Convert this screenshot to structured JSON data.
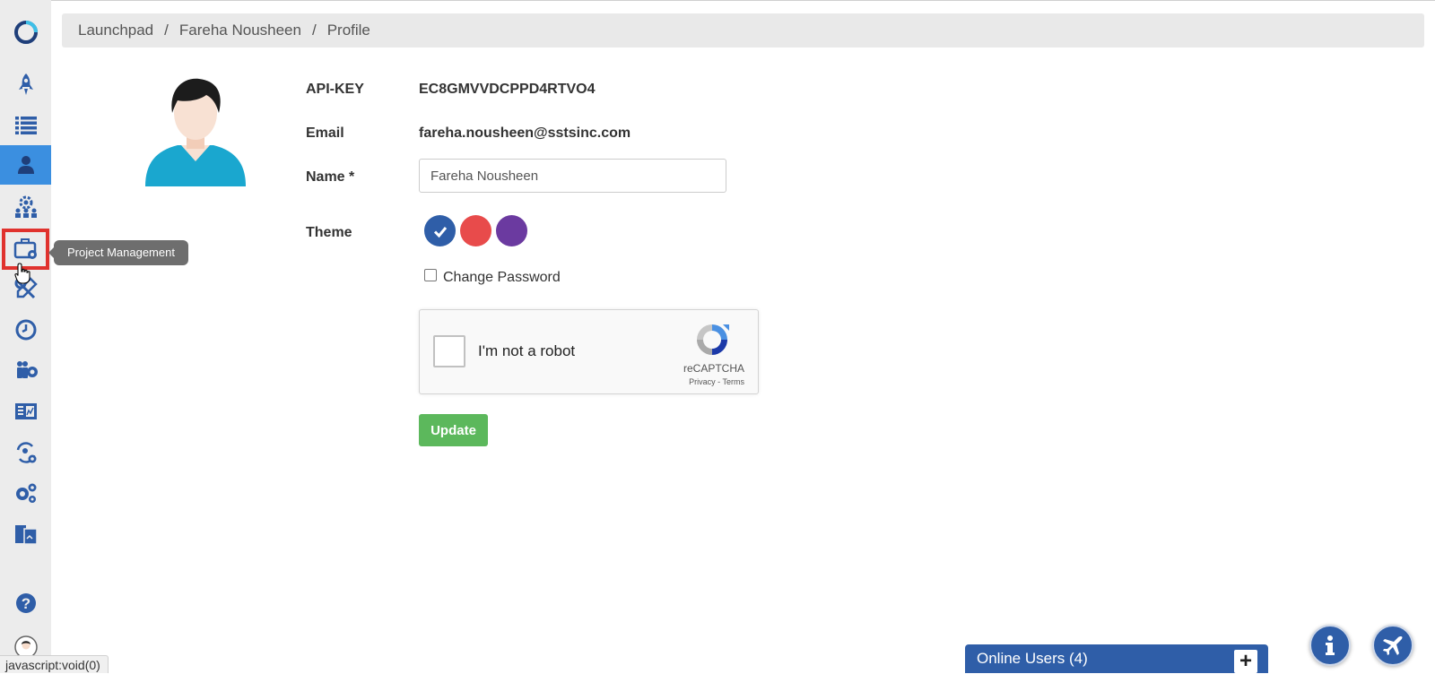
{
  "breadcrumb": {
    "items": [
      "Launchpad",
      "Fareha Nousheen",
      "Profile"
    ],
    "separator": "/"
  },
  "sidebar": {
    "items": [
      {
        "icon": "logo-ring-icon"
      },
      {
        "icon": "rocket-icon"
      },
      {
        "icon": "list-icon"
      },
      {
        "icon": "user-icon",
        "active": true
      },
      {
        "icon": "team-settings-icon"
      },
      {
        "icon": "briefcase-gear-icon",
        "tooltip": "Project Management"
      },
      {
        "icon": "tools-icon"
      },
      {
        "icon": "clock-icon"
      },
      {
        "icon": "people-gear-icon"
      },
      {
        "icon": "report-icon"
      },
      {
        "icon": "user-sync-icon"
      },
      {
        "icon": "gears-icon"
      },
      {
        "icon": "documents-icon"
      },
      {
        "icon": "help-icon"
      },
      {
        "icon": "user-avatar-icon"
      }
    ],
    "tooltip": "Project Management"
  },
  "profile": {
    "api_key_label": "API-KEY",
    "api_key_value": "EC8GMVVDCPPD4RTVO4",
    "email_label": "Email",
    "email_value": "fareha.nousheen@sstsinc.com",
    "name_label": "Name *",
    "name_value": "Fareha Nousheen",
    "theme_label": "Theme",
    "themes": [
      {
        "color": "#2f5ea8",
        "selected": true
      },
      {
        "color": "#e84b4b",
        "selected": false
      },
      {
        "color": "#6b3aa0",
        "selected": false
      }
    ],
    "change_password_label": "Change Password",
    "update_label": "Update"
  },
  "recaptcha": {
    "label": "I'm not a robot",
    "brand": "reCAPTCHA",
    "links": "Privacy - Terms"
  },
  "online_users": {
    "label": "Online Users (4)"
  },
  "fabs": {
    "info_icon": "info-icon",
    "plane_icon": "plane-icon"
  },
  "statusbar": {
    "text": "javascript:void(0)"
  },
  "colors": {
    "primary": "#2f5ea8",
    "active_sidebar": "#3b8fe0",
    "update": "#5cb85c",
    "highlight": "#e0322e"
  }
}
